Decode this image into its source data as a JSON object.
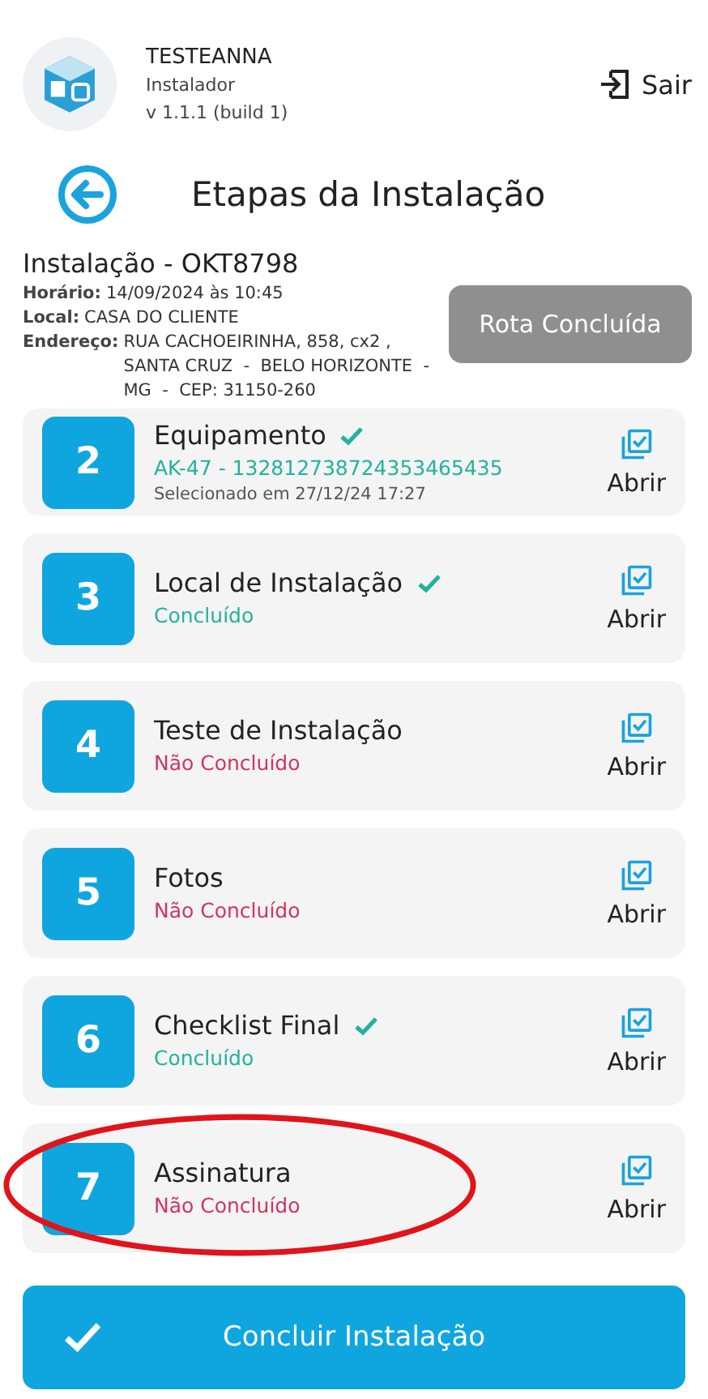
{
  "header": {
    "app_name": "TESTEANNA",
    "role": "Instalador",
    "version": "v 1.1.1 (build 1)",
    "logout": "Sair"
  },
  "page_title": "Etapas da Instalação",
  "installation": {
    "title": "Instalação - OKT8798",
    "fields": [
      {
        "label": "Horário:",
        "value": "14/09/2024 às 10:45"
      },
      {
        "label": "Local:",
        "value": "CASA DO CLIENTE"
      },
      {
        "label": "Endereço:",
        "value": "RUA CACHOEIRINHA, 858, cx2 , SANTA CRUZ  -  BELO HORIZONTE  -  MG  -  CEP: 31150-260"
      }
    ],
    "route_button": {
      "label": "Rota Concluída",
      "disabled": true
    }
  },
  "steps": [
    {
      "number": "2",
      "title": "Equipamento",
      "done": true,
      "status": "AK-47 - 132812738724353465435",
      "detail": "Selecionado em 27/12/24 17:27",
      "action": "Abrir"
    },
    {
      "number": "3",
      "title": "Local de Instalação",
      "done": true,
      "status": "Concluído",
      "action": "Abrir"
    },
    {
      "number": "4",
      "title": "Teste de Instalação",
      "done": false,
      "status": "Não Concluído",
      "action": "Abrir"
    },
    {
      "number": "5",
      "title": "Fotos",
      "done": false,
      "status": "Não Concluído",
      "action": "Abrir"
    },
    {
      "number": "6",
      "title": "Checklist Final",
      "done": true,
      "status": "Concluído",
      "action": "Abrir"
    },
    {
      "number": "7",
      "title": "Assinatura",
      "done": false,
      "status": "Não Concluído",
      "action": "Abrir",
      "highlighted": true
    }
  ],
  "finish_button": "Concluir Instalação"
}
